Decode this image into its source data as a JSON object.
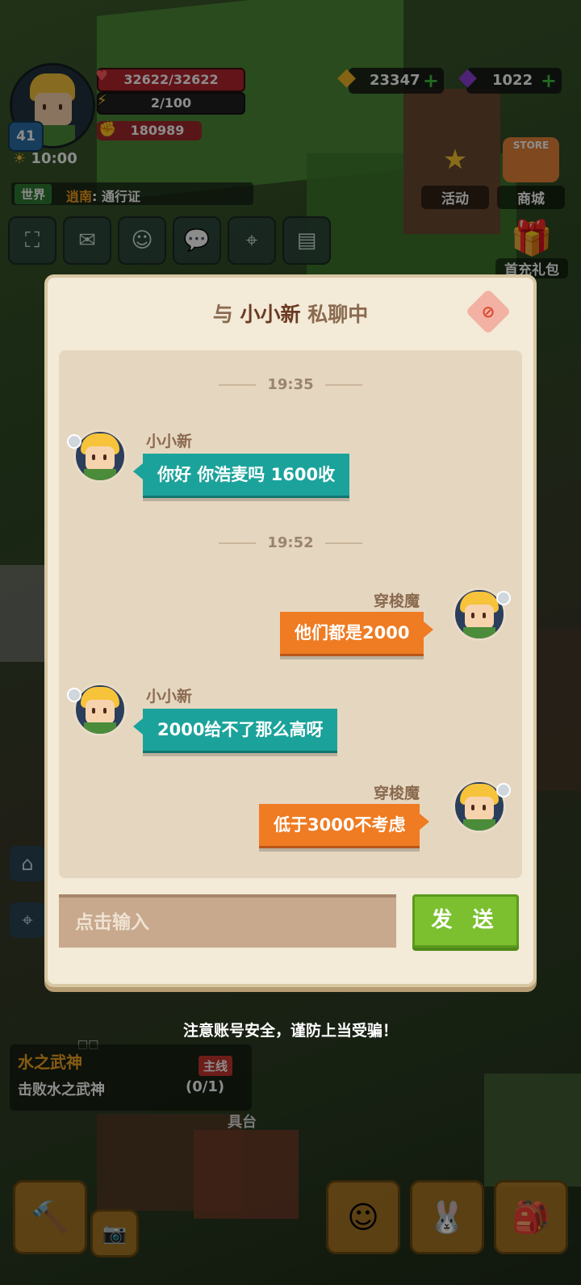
{
  "hud": {
    "level": "41",
    "hp": "32622/32622",
    "xp": "2/100",
    "power": "180989",
    "time": "10:00",
    "world_tag": "世界",
    "world_msg_highlight": "逍南",
    "world_msg_text": ": 通行证",
    "coins": "23347",
    "gems": "1022"
  },
  "side_buttons": {
    "activity": "活动",
    "shop": "商城",
    "store_sign": "STORE",
    "gift": "首充礼包"
  },
  "dialog": {
    "title_prefix": "与 ",
    "title_name": "小小新",
    "title_suffix": " 私聊中",
    "messages": [
      {
        "type": "time",
        "text": "19:35"
      },
      {
        "type": "msg",
        "side": "left",
        "sender": "小小新",
        "text": "你好 你浩麦吗 1600收"
      },
      {
        "type": "time",
        "text": "19:52"
      },
      {
        "type": "msg",
        "side": "right",
        "sender": "穿梭魔",
        "text": "他们都是2000"
      },
      {
        "type": "msg",
        "side": "left",
        "sender": "小小新",
        "text": "2000给不了那么高呀"
      },
      {
        "type": "msg",
        "side": "right",
        "sender": "穿梭魔",
        "text": "低于3000不考虑"
      }
    ],
    "input_placeholder": "点击输入",
    "send_label": "发 送"
  },
  "warning": "注意账号安全，谨防上当受骗！",
  "quest": {
    "title": "水之武神",
    "tag": "主线",
    "desc": "击败水之武神",
    "progress": "(0/1)",
    "workbench": "具台",
    "dots": "□□"
  },
  "colors": {
    "teal_bubble": "#1ba39b",
    "orange_bubble": "#ef7b22",
    "send_green": "#7cc02f",
    "dialog_bg": "#f3ead7"
  }
}
